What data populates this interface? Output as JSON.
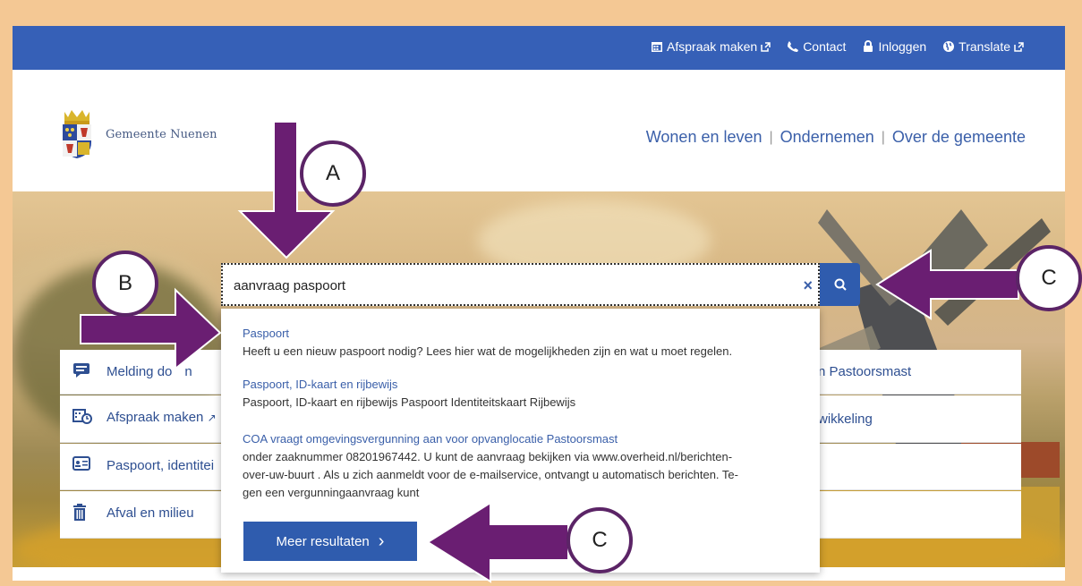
{
  "topbar": {
    "links": [
      {
        "label": "Afspraak maken",
        "icon": "calendar-icon"
      },
      {
        "label": "Contact",
        "icon": "phone-icon"
      },
      {
        "label": "Inloggen",
        "icon": "lock-icon"
      },
      {
        "label": "Translate",
        "icon": "globe-icon"
      }
    ]
  },
  "header": {
    "logo_text": "Gemeente Nuenen",
    "nav": [
      "Wonen en leven",
      "Ondernemen",
      "Over de gemeente"
    ]
  },
  "search": {
    "value": "aanvraag paspoort",
    "clear_label": "×"
  },
  "results": [
    {
      "title": "Paspoort",
      "desc": "Heeft u een nieuw paspoort nodig? Lees hier wat de mogelijkheden zijn en wat u moet regelen."
    },
    {
      "title": "Paspoort, ID-kaart en rijbewijs",
      "desc": "Paspoort, ID-kaart en rijbewijs Paspoort Identiteitskaart Rijbewijs"
    },
    {
      "title": "COA vraagt omgevingsvergunning aan voor opvanglocatie Pastoorsmast",
      "desc_lines": [
        "onder zaaknummer 08201967442. U kunt de aanvraag bekijken via  www.overheid.nl/berichten-",
        "over-uw-buurt . Als u zich aanmeldt voor de e-mailservice, ontvangt u automatisch berichten. Te-",
        "gen een vergunningaanvraag kunt"
      ]
    }
  ],
  "more_button": {
    "label": "Meer resultaten",
    "chevron": "›"
  },
  "tiles_left": [
    {
      "label": "Melding do",
      "label_after": "n",
      "icon": "message-icon"
    },
    {
      "label": "Afspraak maken",
      "icon": "calendar-clock-icon"
    },
    {
      "label": "Paspoort, identitei",
      "icon": "id-card-icon"
    },
    {
      "label": "Afval en milieu",
      "icon": "trash-icon"
    }
  ],
  "tiles_right": [
    {
      "label": "n Pastoorsmast"
    },
    {
      "label": "wikkeling"
    },
    {
      "label": ""
    },
    {
      "label": ""
    }
  ],
  "callouts": {
    "a": "A",
    "b": "B",
    "c1": "C",
    "c2": "C"
  },
  "colors": {
    "brand_blue": "#3660b7",
    "arrow_purple": "#6a1e72",
    "frame": "#f4c894"
  }
}
